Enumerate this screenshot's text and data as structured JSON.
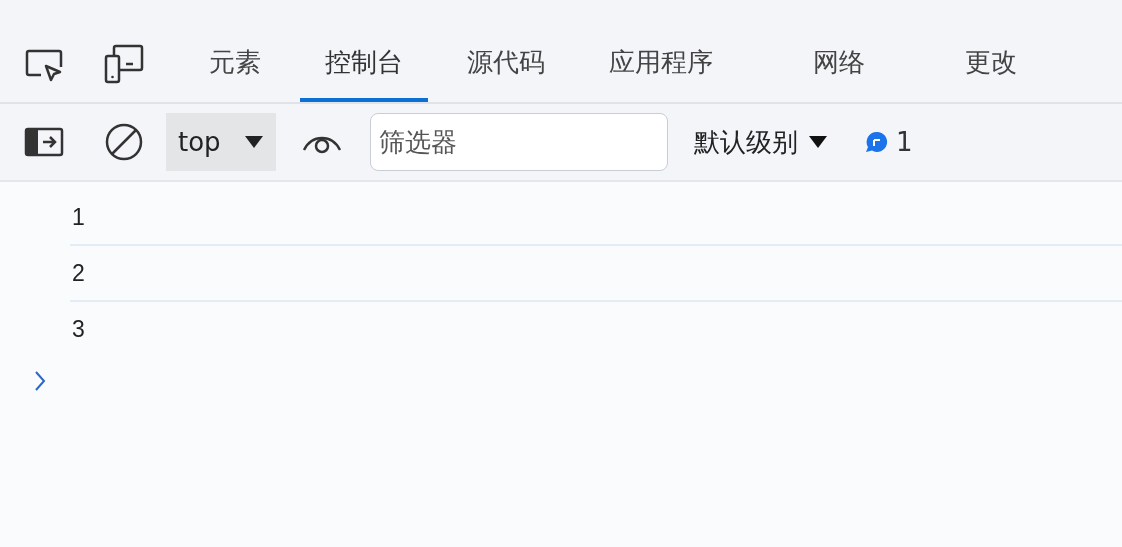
{
  "tabs": [
    {
      "label": "元素",
      "selected": false
    },
    {
      "label": "控制台",
      "selected": true
    },
    {
      "label": "源代码",
      "selected": false
    },
    {
      "label": "应用程序",
      "selected": false
    },
    {
      "label": "网络",
      "selected": false
    },
    {
      "label": "更改",
      "selected": false
    }
  ],
  "toolbar": {
    "context": "top",
    "filter": {
      "placeholder": "筛选器"
    },
    "level": "默认级别",
    "issues": "1"
  },
  "console": {
    "messages": [
      "1",
      "2",
      "3"
    ]
  }
}
